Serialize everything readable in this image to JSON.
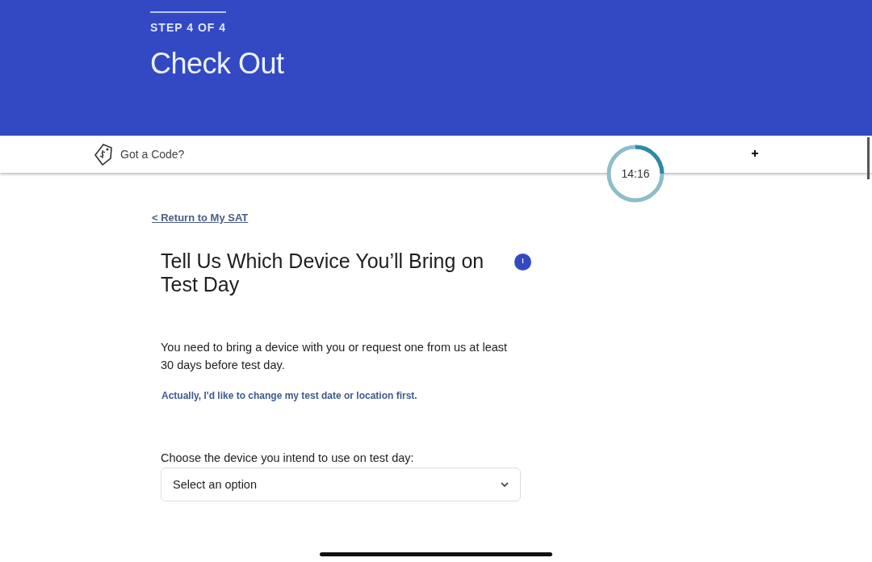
{
  "header": {
    "step": "STEP 4 OF 4",
    "title": "Check Out"
  },
  "promo_bar": {
    "label": "Got a Code?"
  },
  "timer": {
    "time": "14:16",
    "level": 0.25
  },
  "back_link": "< Return to My SAT",
  "heading": "Tell Us Which Device You’ll Bring on Test Day",
  "body": "You need to bring a device with you or request one from us at least 30 days before test day.",
  "change_link": "Actually, I'd like to change my test date or location first.",
  "device_select": {
    "label": "Choose the device you intend to use on test day:",
    "placeholder": "Select an option"
  }
}
